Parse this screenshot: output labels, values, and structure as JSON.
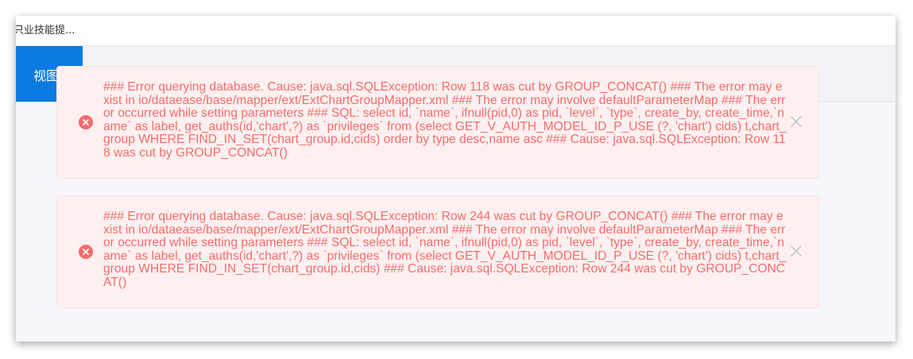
{
  "topbar": {
    "title": "只业技能提..."
  },
  "tabs": {
    "active_label": "视图"
  },
  "alerts": [
    {
      "message": "### Error querying database. Cause: java.sql.SQLException: Row 118 was cut by GROUP_CONCAT() ### The error may exist in io/dataease/base/mapper/ext/ExtChartGroupMapper.xml ### The error may involve defaultParameterMap ### The error occurred while setting parameters ### SQL: select id, `name`, ifnull(pid,0) as pid, `level`, `type`, create_by, create_time,`name` as label, get_auths(id,'chart',?) as `privileges` from (select GET_V_AUTH_MODEL_ID_P_USE (?, 'chart') cids) t,chart_group WHERE FIND_IN_SET(chart_group.id,cids) order by type desc,name asc ### Cause: java.sql.SQLException: Row 118 was cut by GROUP_CONCAT()",
      "icon": "error-circle-icon",
      "close_icon": "close-icon"
    },
    {
      "message": "### Error querying database. Cause: java.sql.SQLException: Row 244 was cut by GROUP_CONCAT() ### The error may exist in io/dataease/base/mapper/ext/ExtChartGroupMapper.xml ### The error may involve defaultParameterMap ### The error occurred while setting parameters ### SQL: select id, `name`, ifnull(pid,0) as pid, `level`, `type`, create_by, create_time,`name` as label, get_auths(id,'chart',?) as `privileges` from (select GET_V_AUTH_MODEL_ID_P_USE (?, 'chart') cids) t,chart_group WHERE FIND_IN_SET(chart_group.id,cids) ### Cause: java.sql.SQLException: Row 244 was cut by GROUP_CONCAT()",
      "icon": "error-circle-icon",
      "close_icon": "close-icon"
    }
  ],
  "colors": {
    "accent": "#0a7be0",
    "error_text": "#f56c6c",
    "error_bg": "#fef0f0",
    "error_border": "#fde2e2",
    "close_icon": "#c0c4cc"
  }
}
